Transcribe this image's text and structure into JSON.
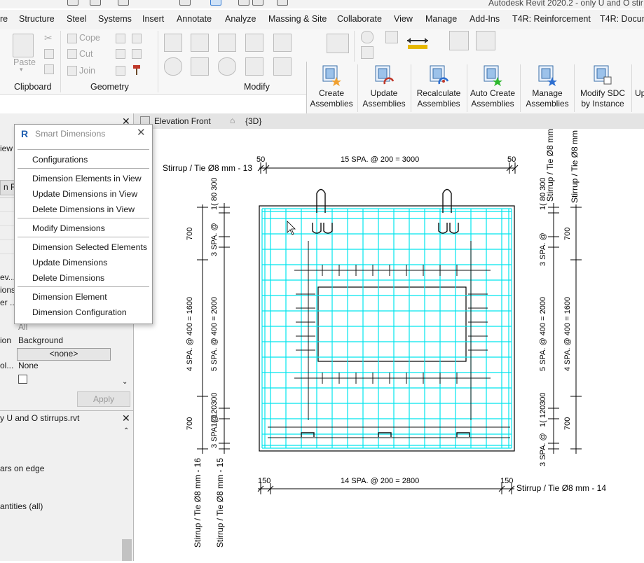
{
  "window": {
    "title": "Autodesk Revit 2020.2 - only U and O stir"
  },
  "menu_tabs": [
    "re",
    "Structure",
    "Steel",
    "Systems",
    "Insert",
    "Annotate",
    "Analyze",
    "Massing & Site",
    "Collaborate",
    "View",
    "Manage",
    "Add-Ins",
    "T4R: Reinforcement",
    "T4R: Docum"
  ],
  "ribbon": {
    "clipboard": {
      "label": "Clipboard",
      "paste": "Paste"
    },
    "geometry": {
      "label": "Geometry",
      "cope": "Cope",
      "cut": "Cut",
      "join": "Join"
    },
    "modify": {
      "label": "Modify"
    }
  },
  "t4r_buttons": [
    {
      "line1": "Create",
      "line2": "Assemblies"
    },
    {
      "line1": "Update",
      "line2": "Assemblies"
    },
    {
      "line1": "Recalculate",
      "line2": "Assemblies"
    },
    {
      "line1": "Auto Create",
      "line2": "Assemblies"
    },
    {
      "line1": "Manage",
      "line2": "Assemblies"
    },
    {
      "line1": "Modify SDC",
      "line2": "by Instance"
    },
    {
      "line1": "Up",
      "line2": ""
    }
  ],
  "view_tabs": {
    "elevation": "Elevation Front",
    "threeD": "{3D}"
  },
  "popup": {
    "title": "Smart Dimensions",
    "items": [
      "Configurations",
      "Dimension Elements in View",
      "Update Dimensions in View",
      "Delete Dimensions in View",
      "Modify Dimensions",
      "Dimension Selected Elements",
      "Update Dimensions",
      "Delete Dimensions",
      "Dimension Element",
      "Dimension Configuration"
    ]
  },
  "properties": {
    "iew": "iew",
    "n_fro": "n Fro",
    "ev": "ev...",
    "ions": "ions",
    "er": "er ...",
    "all": "All",
    "ion": "ion",
    "background": "Background",
    "none_btn": "<none>",
    "ol": "ol...",
    "none": "None",
    "apply": "Apply"
  },
  "project_browser": {
    "title": "y U and O stirrups.rvt",
    "item1": "ars on edge",
    "item2": "antities (all)"
  },
  "dimensions": {
    "top_label": "Stirrup / Tie Ø8 mm - 13",
    "top_left": "50",
    "top_mid": "15 SPA. @  200 = 3000",
    "top_right": "50",
    "bottom_left": "150",
    "bottom_mid": "14 SPA. @  200 = 2800",
    "bottom_right": "150",
    "bottom_label": "Stirrup / Tie Ø8 mm - 14",
    "left1_label": "Stirrup / Tie Ø8 mm - 16",
    "left2_label": "Stirrup / Tie Ø8 mm - 15",
    "left_outer": [
      "700",
      "4 SPA. @  400 = 1600",
      "700"
    ],
    "left_inner": [
      "1( 80 300",
      "3 SPA. @",
      "5 SPA. @  400 = 2000",
      "1( 120300",
      "3 SPA. @"
    ],
    "right_labels": [
      "Stirrup / Tie Ø8 mm",
      "Stirrup / Tie Ø8 mm"
    ],
    "right_inner": [
      "1( 80 300",
      "3 SPA. @",
      "5 SPA. @  400 = 2000",
      "1( 120300",
      "3 SPA. @"
    ],
    "right_outer": [
      "700",
      "4 SPA. @  400 = 1600",
      "700"
    ]
  },
  "colors": {
    "rebar": "#00e5ee",
    "t4r_blue": "#3a7fd5",
    "accent_green": "#2eb82e",
    "accent_orange": "#f0a030"
  }
}
